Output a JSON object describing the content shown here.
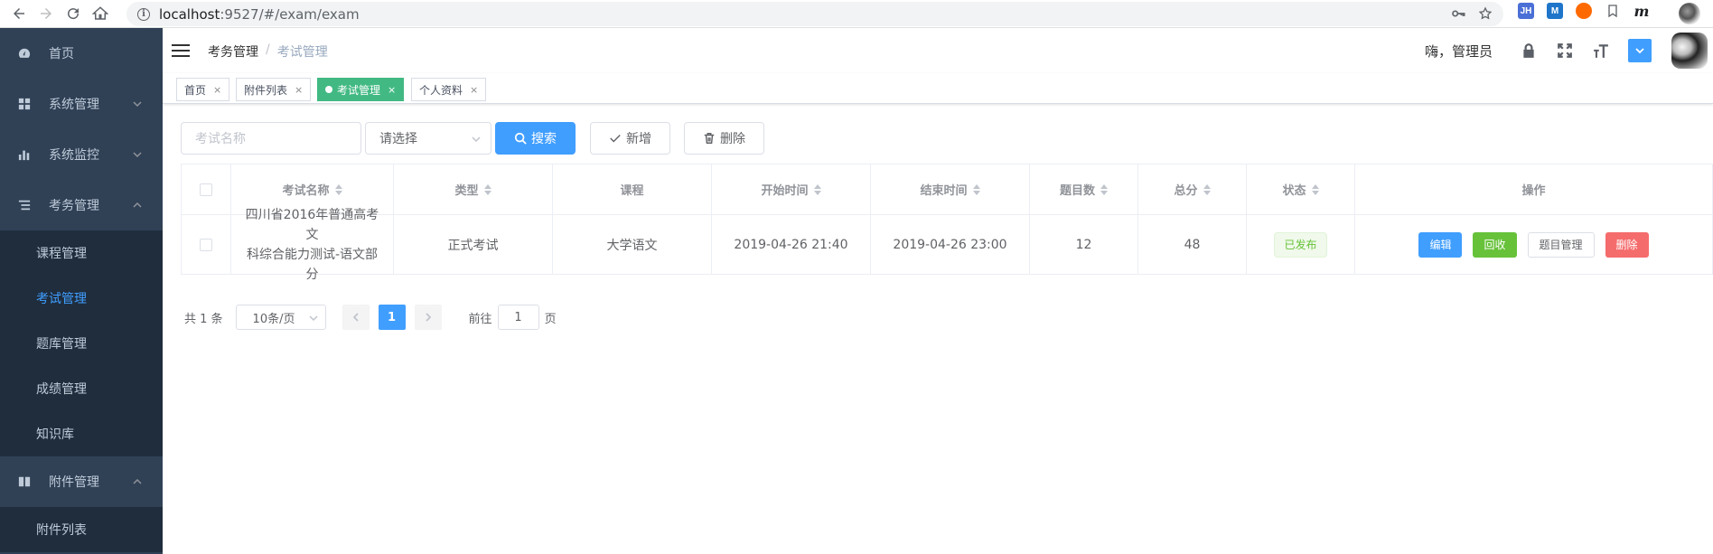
{
  "browser": {
    "url_host": "localhost",
    "url_path": ":9527/#/exam/exam",
    "extensions": [
      "JH",
      "M",
      "",
      "",
      "m"
    ]
  },
  "sidebar": {
    "items": [
      {
        "label": "首页",
        "icon": "dashboard-icon"
      },
      {
        "label": "系统管理",
        "icon": "grid-icon"
      },
      {
        "label": "系统监控",
        "icon": "chart-icon"
      },
      {
        "label": "考务管理",
        "icon": "list-icon",
        "children": [
          "课程管理",
          "考试管理",
          "题库管理",
          "成绩管理",
          "知识库"
        ],
        "active_child": "考试管理"
      },
      {
        "label": "附件管理",
        "icon": "book-icon",
        "children": [
          "附件列表"
        ]
      }
    ]
  },
  "navbar": {
    "breadcrumb": [
      "考务管理",
      "考试管理"
    ],
    "breadcrumb_sep": "/",
    "greeting": "嗨，管理员"
  },
  "tags": [
    {
      "label": "首页",
      "close": "×"
    },
    {
      "label": "附件列表",
      "close": "×"
    },
    {
      "label": "考试管理",
      "close": "×",
      "active": true
    },
    {
      "label": "个人资料",
      "close": "×"
    }
  ],
  "filters": {
    "name_placeholder": "考试名称",
    "type_select": "请选择",
    "search_label": "搜索",
    "add_label": "新增",
    "delete_label": "删除"
  },
  "table": {
    "columns": [
      "考试名称",
      "类型",
      "课程",
      "开始时间",
      "结束时间",
      "题目数",
      "总分",
      "状态",
      "操作"
    ],
    "rows": [
      {
        "name_line1": "四川省2016年普通高考文",
        "name_line2": "科综合能力测试-语文部分",
        "type": "正式考试",
        "course": "大学语文",
        "start": "2019-04-26 21:40",
        "end": "2019-04-26 23:00",
        "questions": "12",
        "score": "48",
        "status": "已发布",
        "actions": [
          "编辑",
          "回收",
          "题目管理",
          "删除"
        ]
      }
    ]
  },
  "pagination": {
    "total": "共 1 条",
    "page_size": "10条/页",
    "current": "1",
    "jump_prefix": "前往",
    "jump_value": "1",
    "jump_suffix": "页"
  },
  "colors": {
    "sidebar_bg": "#304156",
    "primary": "#409eff",
    "tag_active": "#42b983",
    "success": "#67c23a",
    "danger": "#f56c6c"
  }
}
